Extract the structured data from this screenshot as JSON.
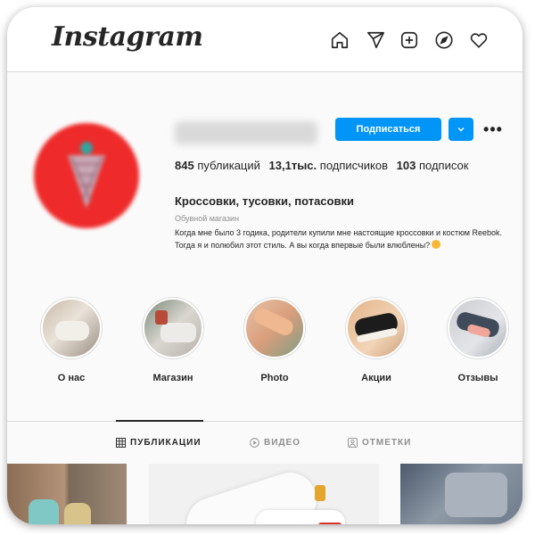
{
  "app": {
    "logo_text": "Instagram"
  },
  "nav_icons": [
    "home-icon",
    "direct-icon",
    "new-post-icon",
    "explore-icon",
    "activity-heart-icon"
  ],
  "profile": {
    "follow_label": "Подписаться",
    "stats": {
      "posts_count": "845",
      "posts_label": "публикаций",
      "followers_count": "13,1тыс.",
      "followers_label": "подписчиков",
      "following_count": "103",
      "following_label": "подписок"
    },
    "bio": {
      "name": "Кроссовки, тусовки, потасовки",
      "category": "Обувной магазин",
      "text": "Когда мне было 3 годика, родители купили мне настоящие кроссовки и костюм Reebok. Тогда я и полюбил этот стиль. А вы когда впервые были влюблены?"
    }
  },
  "highlights": [
    {
      "label": "О нас"
    },
    {
      "label": "Магазин"
    },
    {
      "label": "Photo"
    },
    {
      "label": "Акции"
    },
    {
      "label": "Отзывы"
    }
  ],
  "tabs": [
    {
      "label": "ПУБЛИКАЦИИ",
      "icon": "grid-icon",
      "active": true
    },
    {
      "label": "ВИДЕО",
      "icon": "video-icon",
      "active": false
    },
    {
      "label": "ОТМЕТКИ",
      "icon": "tagged-icon",
      "active": false
    }
  ],
  "colors": {
    "accent": "#0095f6",
    "text": "#262626",
    "muted": "#8e8e8e",
    "avatar_bg": "#ee2a2a"
  }
}
